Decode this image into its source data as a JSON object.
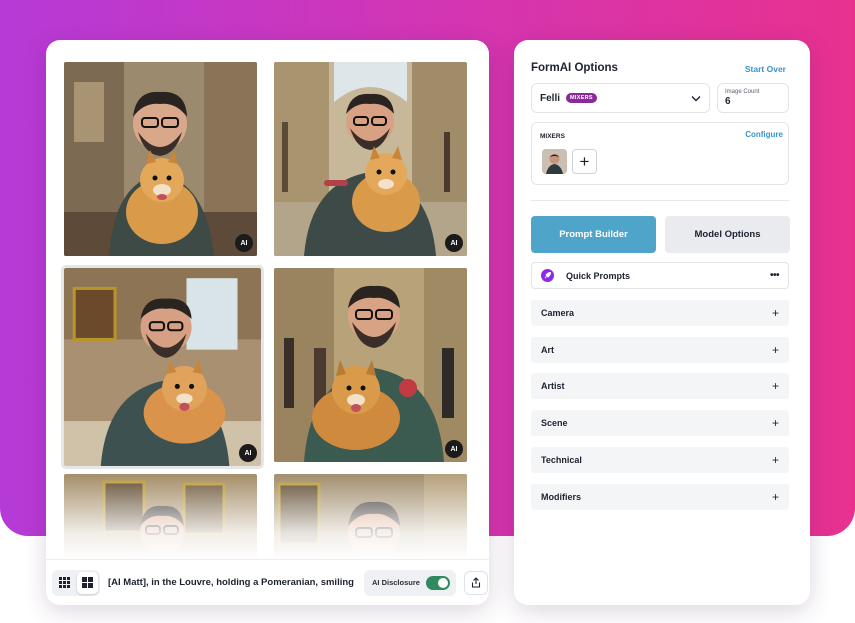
{
  "gallery": {
    "images": [
      {
        "badge": "AI"
      },
      {
        "badge": "AI"
      },
      {
        "badge": "AI"
      },
      {
        "badge": "AI"
      },
      {
        "badge": ""
      },
      {
        "badge": ""
      }
    ],
    "prompt": "[AI Matt], in the Louvre, holding a Pomeranian, smiling",
    "ai_disclosure_label": "AI Disclosure",
    "ai_disclosure_on": true,
    "view_modes": [
      "grid-small-icon",
      "grid-large-icon"
    ],
    "share_icon": "share-icon"
  },
  "options": {
    "title": "FormAI Options",
    "start_over": "Start Over",
    "model": {
      "name": "Felli",
      "pill": "MIXERS"
    },
    "image_count": {
      "label": "Image Count",
      "value": "6"
    },
    "mixers": {
      "label": "MIXERS",
      "configure": "Configure",
      "add_icon": "+"
    },
    "tabs": [
      {
        "label": "Prompt Builder",
        "active": true
      },
      {
        "label": "Model Options",
        "active": false
      }
    ],
    "quick_prompts": {
      "label": "Quick Prompts",
      "more": "•••"
    },
    "sections": [
      {
        "label": "Camera",
        "icon": "+"
      },
      {
        "label": "Art",
        "icon": "+"
      },
      {
        "label": "Artist",
        "icon": "+"
      },
      {
        "label": "Scene",
        "icon": "+"
      },
      {
        "label": "Technical",
        "icon": "+"
      },
      {
        "label": "Modifiers",
        "icon": "+"
      }
    ]
  },
  "colors": {
    "gradient_start": "#b53ad7",
    "gradient_end": "#e8318f",
    "accent_blue": "#4ea4c9",
    "link_blue": "#3a93c8",
    "toggle_green": "#2f8a5f",
    "pill_purple": "#8a2a9a"
  }
}
